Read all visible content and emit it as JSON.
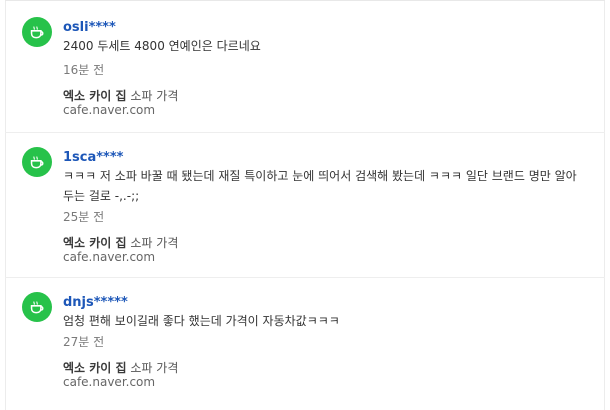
{
  "comments": [
    {
      "nickname": "osli****",
      "text": "2400 두세트 4800 연예인은 다르네요",
      "time": "16분 전",
      "source_name": "엑소 카이 집",
      "source_rest": "소파 가격",
      "source_url": "cafe.naver.com"
    },
    {
      "nickname": "1sca****",
      "text": "ㅋㅋㅋ 저 소파 바꿀 때 됐는데 재질 특이하고 눈에 띄어서 검색해 봤는데 ㅋㅋㅋ 일단 브랜드 명만 알아두는 걸로 -,.-;;",
      "time": "25분 전",
      "source_name": "엑소 카이 집",
      "source_rest": "소파 가격",
      "source_url": "cafe.naver.com"
    },
    {
      "nickname": "dnjs*****",
      "text": "엄청 편해 보이길래 좋다 했는데 가격이 자동차값ㅋㅋㅋ",
      "time": "27분 전",
      "source_name": "엑소 카이 집",
      "source_rest": "소파 가격",
      "source_url": "cafe.naver.com"
    }
  ],
  "colors": {
    "avatar": "#27c24a",
    "nickname": "#1d57b8"
  },
  "icons": {
    "avatar": "coffee-cup-icon"
  }
}
